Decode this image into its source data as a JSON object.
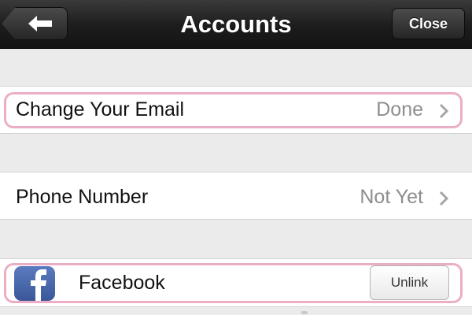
{
  "nav": {
    "title": "Accounts",
    "back_icon": "back-arrow-icon",
    "close_label": "Close"
  },
  "rows": {
    "email": {
      "label": "Change Your Email",
      "value": "Done",
      "icon": "chevron-right-icon"
    },
    "phone": {
      "label": "Phone Number",
      "value": "Not Yet",
      "icon": "chevron-right-icon"
    },
    "facebook": {
      "label": "Facebook",
      "icon": "facebook-logo-icon",
      "button_label": "Unlink"
    }
  },
  "colors": {
    "navbar": "#1c1c1c",
    "background": "#ebebeb",
    "value_text": "#8e8e8e",
    "highlight": "#ebaec6",
    "facebook_blue": "#3b5998"
  }
}
